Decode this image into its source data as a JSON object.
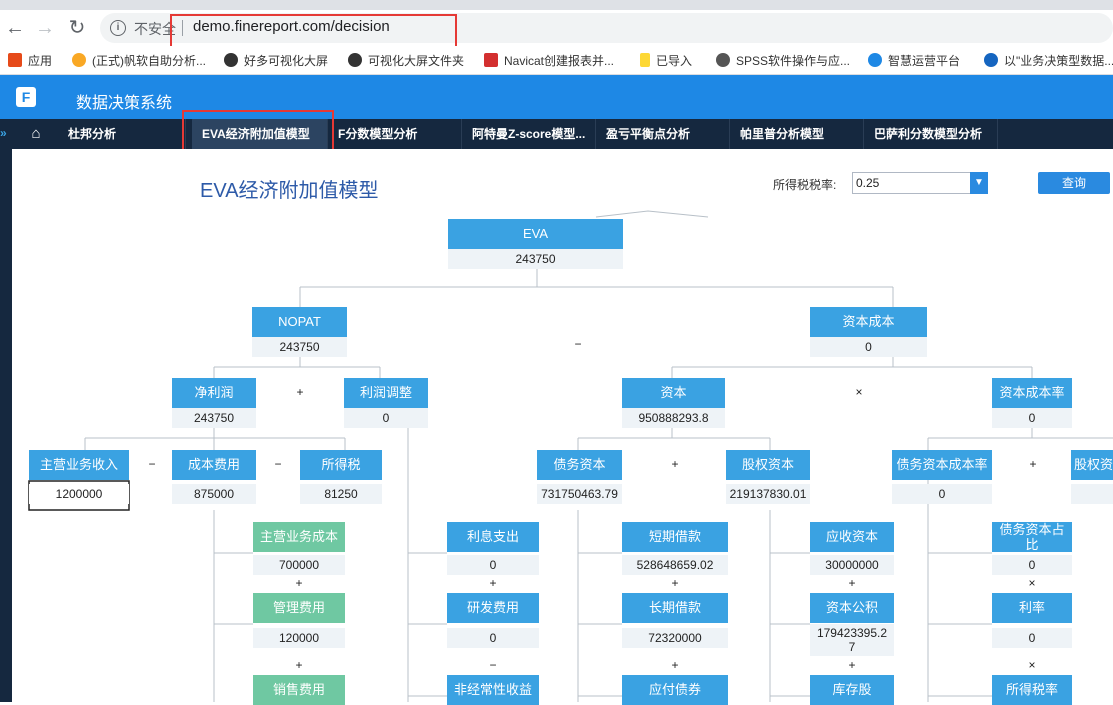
{
  "browser": {
    "insecure_label": "不安全",
    "url": "demo.finereport.com/decision",
    "bookmarks": [
      {
        "label": "应用",
        "color": "#e64a19"
      },
      {
        "label": "(正式)帆软自助分析...",
        "color": "#f9a825"
      },
      {
        "label": "好多可视化大屏",
        "color": "#333333"
      },
      {
        "label": "可视化大屏文件夹",
        "color": "#333333"
      },
      {
        "label": "Navicat创建报表并...",
        "color": "#d32f2f"
      },
      {
        "label": "已导入",
        "color": "#fdd835"
      },
      {
        "label": "SPSS软件操作与应...",
        "color": "#555555"
      },
      {
        "label": "智慧运营平台",
        "color": "#1e88e5"
      },
      {
        "label": "以\"业务决策型数据...",
        "color": "#1565c0"
      }
    ]
  },
  "app": {
    "title": "数据决策系统",
    "tabs": [
      {
        "label": "杜邦分析"
      },
      {
        "label": "EVA经济附加值模型"
      },
      {
        "label": "F分数模型分析"
      },
      {
        "label": "阿特曼Z-score模型..."
      },
      {
        "label": "盈亏平衡点分析"
      },
      {
        "label": "帕里普分析模型"
      },
      {
        "label": "巴萨利分数模型分析"
      }
    ]
  },
  "page": {
    "title": "EVA经济附加值模型",
    "tax_label": "所得税税率:",
    "tax_value": "0.25",
    "query_label": "查询"
  },
  "tree": {
    "eva": {
      "label": "EVA",
      "value": "243750"
    },
    "nopat": {
      "label": "NOPAT",
      "value": "243750"
    },
    "capital_cost": {
      "label": "资本成本",
      "value": "0"
    },
    "net_profit": {
      "label": "净利润",
      "value": "243750"
    },
    "profit_adj": {
      "label": "利润调整",
      "value": "0"
    },
    "capital": {
      "label": "资本",
      "value": "950888293.8"
    },
    "capital_cost_rate": {
      "label": "资本成本率",
      "value": "0"
    },
    "main_revenue": {
      "label": "主营业务收入",
      "value": "1200000"
    },
    "cost_expense": {
      "label": "成本费用",
      "value": "875000"
    },
    "income_tax": {
      "label": "所得税",
      "value": "81250"
    },
    "debt_capital": {
      "label": "债务资本",
      "value": "731750463.79"
    },
    "equity_capital": {
      "label": "股权资本",
      "value": "219137830.01"
    },
    "debt_cost_rate": {
      "label": "债务资本成本率",
      "value": "0"
    },
    "equity_cost_rate": {
      "label": "股权资"
    },
    "main_cost": {
      "label": "主营业务成本",
      "value": "700000"
    },
    "mgmt_expense": {
      "label": "管理费用",
      "value": "120000"
    },
    "sales_expense": {
      "label": "销售费用"
    },
    "interest_exp": {
      "label": "利息支出",
      "value": "0"
    },
    "rd_exp": {
      "label": "研发费用",
      "value": "0"
    },
    "nonrecurring": {
      "label": "非经常性收益"
    },
    "short_loan": {
      "label": "短期借款",
      "value": "528648659.02"
    },
    "long_loan": {
      "label": "长期借款",
      "value": "72320000"
    },
    "bonds": {
      "label": "应付债券"
    },
    "paid_capital": {
      "label": "应收资本",
      "value": "30000000"
    },
    "capital_reserve": {
      "label": "资本公积",
      "value": "179423395.2",
      "value2": "7"
    },
    "treasury": {
      "label": "库存股"
    },
    "debt_ratio": {
      "label": "债务资本占",
      "label2": "比",
      "value": "0"
    },
    "interest_rate": {
      "label": "利率",
      "value": "0"
    },
    "tax_rate": {
      "label": "所得税率"
    },
    "ops": {
      "minus": "−",
      "plus": "+",
      "times": "×"
    }
  }
}
